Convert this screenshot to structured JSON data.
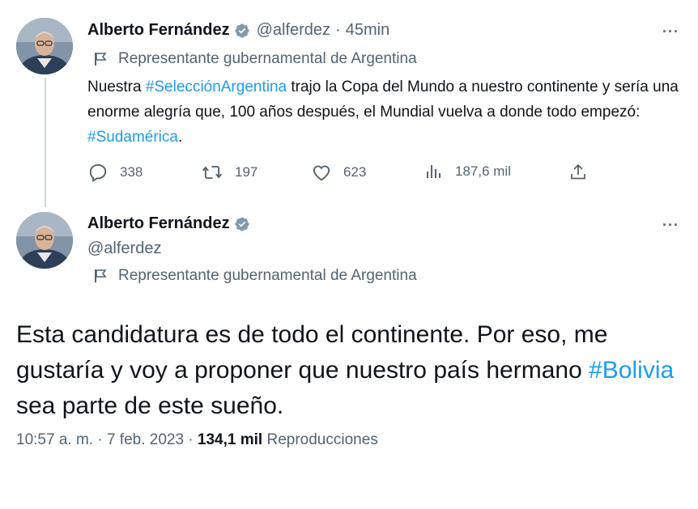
{
  "tweet1": {
    "author_name": "Alberto Fernández",
    "handle": "@alferdez",
    "separator": "·",
    "time": "45min",
    "more": "···",
    "label": "Representante gubernamental de Argentina",
    "text_parts": {
      "p1": "Nuestra ",
      "h1": "#SelecciónArgentina",
      "p2": " trajo la Copa del Mundo a nuestro continente y sería una enorme alegría que, 100 años después, el Mundial vuelva a donde todo empezó: ",
      "h2": "#Sudamérica",
      "p3": "."
    },
    "actions": {
      "replies": "338",
      "retweets": "197",
      "likes": "623",
      "views": "187,6 mil"
    }
  },
  "tweet2": {
    "author_name": "Alberto Fernández",
    "handle": "@alferdez",
    "more": "···",
    "label": "Representante gubernamental de Argentina",
    "text_parts": {
      "p1": "Esta candidatura es de todo el continente. Por eso, me gustaría y voy a proponer que nuestro país hermano ",
      "h1": "#Bolivia",
      "p2": " sea parte de este sueño."
    },
    "timestamp": "10:57 a. m. · 7 feb. 2023 · ",
    "views_count": "134,1 mil",
    "views_label": " Reproducciones"
  },
  "colors": {
    "text": "#0f1419",
    "secondary": "#536471",
    "link": "#1d9bf0",
    "verified": "#829aab",
    "thread_line": "#cfd9de"
  },
  "icons": [
    "verified-badge-icon",
    "more-icon",
    "government-flag-icon",
    "reply-icon",
    "retweet-icon",
    "like-icon",
    "views-icon",
    "share-icon"
  ]
}
